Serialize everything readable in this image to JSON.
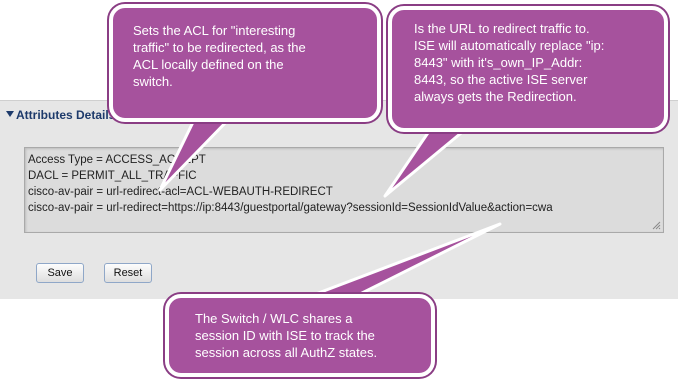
{
  "section": {
    "title": "Attributes Details"
  },
  "attributes": {
    "lines": [
      "Access Type = ACCESS_ACCEPT",
      "DACL = PERMIT_ALL_TRAFFIC",
      "cisco-av-pair = url-redirect-acl=ACL-WEBAUTH-REDIRECT",
      "cisco-av-pair = url-redirect=https://ip:8443/guestportal/gateway?sessionId=SessionIdValue&action=cwa"
    ]
  },
  "buttons": {
    "save_label": "Save",
    "reset_label": "Reset"
  },
  "callouts": {
    "acl": [
      "Sets the ACL for \"interesting",
      "traffic\" to be redirected, as the",
      "ACL locally defined on the",
      "switch."
    ],
    "url": [
      "Is the URL to redirect traffic to.",
      "ISE will automatically replace \"ip:",
      "8443\" with it's_own_IP_Addr:",
      "8443, so the active ISE server",
      "always gets the Redirection."
    ],
    "session": [
      "The Switch / WLC shares a",
      "session ID with ISE to track the",
      "session across all AuthZ states."
    ]
  },
  "colors": {
    "callout_fill": "#a6529d",
    "callout_border": "#ffffff",
    "panel_bg": "#e6e6e6",
    "header_text": "#1d3a6b"
  }
}
